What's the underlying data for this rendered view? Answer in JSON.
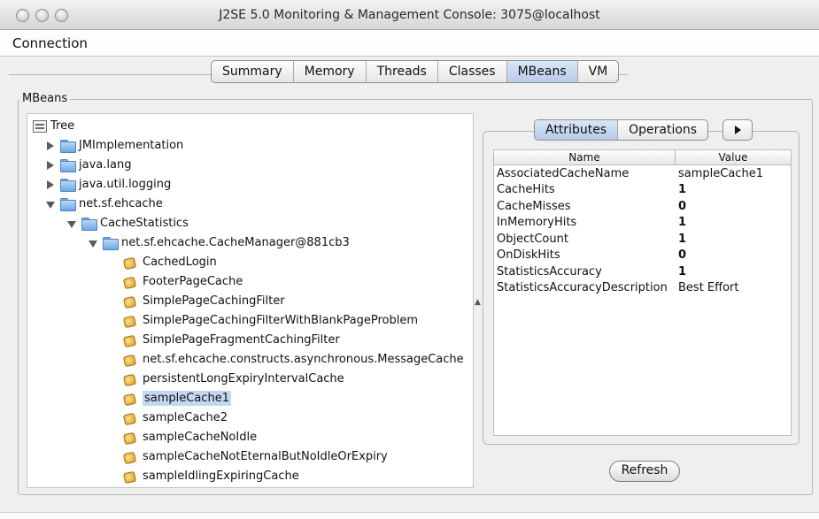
{
  "window": {
    "title": "J2SE 5.0 Monitoring & Management Console: 3075@localhost"
  },
  "menubar": {
    "items": [
      "Connection"
    ]
  },
  "tabs": [
    {
      "label": "Summary"
    },
    {
      "label": "Memory"
    },
    {
      "label": "Threads"
    },
    {
      "label": "Classes"
    },
    {
      "label": "MBeans",
      "active": true
    },
    {
      "label": "VM"
    }
  ],
  "mbeans_panel": {
    "label": "MBeans"
  },
  "tree": {
    "root": "Tree",
    "nodes": [
      {
        "label": "JMImplementation",
        "depth": 1,
        "expanded": false,
        "type": "folder"
      },
      {
        "label": "java.lang",
        "depth": 1,
        "expanded": false,
        "type": "folder"
      },
      {
        "label": "java.util.logging",
        "depth": 1,
        "expanded": false,
        "type": "folder"
      },
      {
        "label": "net.sf.ehcache",
        "depth": 1,
        "expanded": true,
        "type": "folder"
      },
      {
        "label": "CacheStatistics",
        "depth": 2,
        "expanded": true,
        "type": "folder"
      },
      {
        "label": "net.sf.ehcache.CacheManager@881cb3",
        "depth": 3,
        "expanded": true,
        "type": "folder"
      },
      {
        "label": "CachedLogin",
        "depth": 4,
        "type": "bean"
      },
      {
        "label": "FooterPageCache",
        "depth": 4,
        "type": "bean"
      },
      {
        "label": "SimplePageCachingFilter",
        "depth": 4,
        "type": "bean"
      },
      {
        "label": "SimplePageCachingFilterWithBlankPageProblem",
        "depth": 4,
        "type": "bean"
      },
      {
        "label": "SimplePageFragmentCachingFilter",
        "depth": 4,
        "type": "bean"
      },
      {
        "label": "net.sf.ehcache.constructs.asynchronous.MessageCache",
        "depth": 4,
        "type": "bean"
      },
      {
        "label": "persistentLongExpiryIntervalCache",
        "depth": 4,
        "type": "bean"
      },
      {
        "label": "sampleCache1",
        "depth": 4,
        "type": "bean",
        "selected": true
      },
      {
        "label": "sampleCache2",
        "depth": 4,
        "type": "bean"
      },
      {
        "label": "sampleCacheNoIdle",
        "depth": 4,
        "type": "bean"
      },
      {
        "label": "sampleCacheNotEternalButNoIdleOrExpiry",
        "depth": 4,
        "type": "bean"
      },
      {
        "label": "sampleIdlingExpiringCache",
        "depth": 4,
        "type": "bean"
      }
    ]
  },
  "detail_tabs": [
    {
      "label": "Attributes",
      "active": true
    },
    {
      "label": "Operations"
    }
  ],
  "more_tabs_icon": "right-arrow-icon",
  "attributes": {
    "columns": [
      "Name",
      "Value"
    ],
    "rows": [
      {
        "name": "AssociatedCacheName",
        "value": "sampleCache1"
      },
      {
        "name": "CacheHits",
        "value": "1"
      },
      {
        "name": "CacheMisses",
        "value": "0"
      },
      {
        "name": "InMemoryHits",
        "value": "1"
      },
      {
        "name": "ObjectCount",
        "value": "1"
      },
      {
        "name": "OnDiskHits",
        "value": "0"
      },
      {
        "name": "StatisticsAccuracy",
        "value": "1"
      },
      {
        "name": "StatisticsAccuracyDescription",
        "value": "Best Effort"
      }
    ]
  },
  "refresh_button": {
    "label": "Refresh"
  }
}
